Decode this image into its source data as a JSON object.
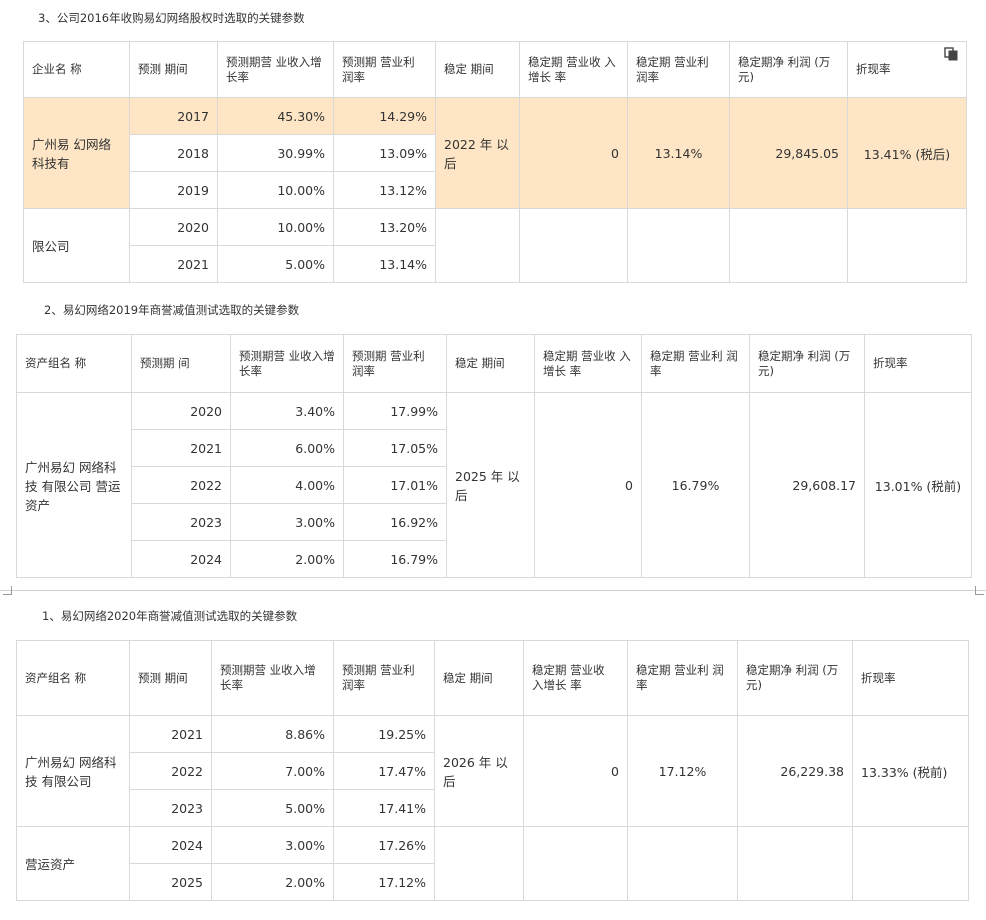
{
  "sections": [
    {
      "heading": "3、公司2016年收购易幻网络股权时选取的关键参数",
      "headers": [
        "企业名 称",
        "预测 期间",
        "预测期营 业收入增 长率",
        "预测期 营业利 润率",
        "稳定 期间",
        "稳定期 营业收 入增长 率",
        "稳定期 营业利 润率",
        "稳定期净 利润 (万元)",
        "折现率"
      ],
      "entity_top": "广州易 幻网络 科技有",
      "entity_bottom": "限公司",
      "years": [
        "2017",
        "2018",
        "2019",
        "2020",
        "2021"
      ],
      "revenue_growth": [
        "45.30%",
        "30.99%",
        "10.00%",
        "10.00%",
        "5.00%"
      ],
      "op_margin": [
        "14.29%",
        "13.09%",
        "13.12%",
        "13.20%",
        "13.14%"
      ],
      "stable_period": "2022 年 以后",
      "stable_growth": "0",
      "stable_margin": "13.14%",
      "stable_profit": "29,845.05",
      "discount_rate": "13.41% (税后)"
    },
    {
      "heading": "2、易幻网络2019年商誉减值测试选取的关键参数",
      "headers": [
        "资产组名 称",
        "预测期 间",
        "预测期营 业收入增 长率",
        "预测期 营业利 润率",
        "稳定 期间",
        "稳定期 营业收 入增长 率",
        "稳定期 营业利 润率",
        "稳定期净 利润 (万元)",
        "折现率"
      ],
      "entity": "广州易幻 网络科技 有限公司 营运资产",
      "years": [
        "2020",
        "2021",
        "2022",
        "2023",
        "2024"
      ],
      "revenue_growth": [
        "3.40%",
        "6.00%",
        "4.00%",
        "3.00%",
        "2.00%"
      ],
      "op_margin": [
        "17.99%",
        "17.05%",
        "17.01%",
        "16.92%",
        "16.79%"
      ],
      "stable_period": "2025 年 以后",
      "stable_growth": "0",
      "stable_margin": "16.79%",
      "stable_profit": "29,608.17",
      "discount_rate": "13.01% (税前)"
    },
    {
      "heading": "1、易幻网络2020年商誉减值测试选取的关键参数",
      "headers": [
        "资产组名 称",
        "预测 期间",
        "预测期营 业收入增 长率",
        "预测期 营业利 润率",
        "稳定 期间",
        "稳定期 营业收 入增长 率",
        "稳定期 营业利 润率",
        "稳定期净 利润 (万元)",
        "折现率"
      ],
      "entity_top": "广州易幻 网络科技 有限公司",
      "entity_bottom": "营运资产",
      "years": [
        "2021",
        "2022",
        "2023",
        "2024",
        "2025"
      ],
      "revenue_growth": [
        "8.86%",
        "7.00%",
        "5.00%",
        "3.00%",
        "2.00%"
      ],
      "op_margin": [
        "19.25%",
        "17.47%",
        "17.41%",
        "17.26%",
        "17.12%"
      ],
      "stable_period": "2026 年 以后",
      "stable_growth": "0",
      "stable_margin": "17.12%",
      "stable_profit": "26,229.38",
      "discount_rate": "13.33% (税前)"
    }
  ],
  "icons": {
    "copy": "copy-icon"
  },
  "colors": {
    "highlight": "#fde5c5",
    "border": "#d9d9d9"
  }
}
